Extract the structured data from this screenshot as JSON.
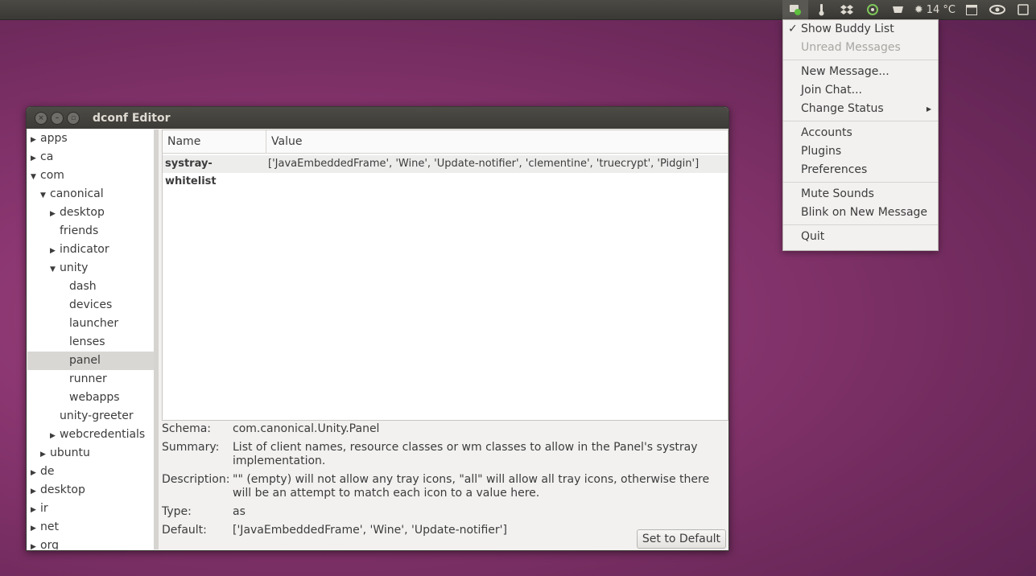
{
  "panel": {
    "temperature": "14 °C",
    "calendar_day": "10",
    "icons": [
      "pidgin-icon",
      "thermometer-icon",
      "dropbox-icon",
      "clementine-icon",
      "cup-icon",
      "weather-icon",
      "calendar-icon",
      "eye-icon",
      "session-icon"
    ]
  },
  "window": {
    "title": "dconf Editor",
    "tree": [
      {
        "label": "apps",
        "depth": 0,
        "arrow": "▶"
      },
      {
        "label": "ca",
        "depth": 0,
        "arrow": "▶"
      },
      {
        "label": "com",
        "depth": 0,
        "arrow": "▼"
      },
      {
        "label": "canonical",
        "depth": 1,
        "arrow": "▼"
      },
      {
        "label": "desktop",
        "depth": 2,
        "arrow": "▶"
      },
      {
        "label": "friends",
        "depth": 2,
        "arrow": ""
      },
      {
        "label": "indicator",
        "depth": 2,
        "arrow": "▶"
      },
      {
        "label": "unity",
        "depth": 2,
        "arrow": "▼"
      },
      {
        "label": "dash",
        "depth": 3,
        "arrow": ""
      },
      {
        "label": "devices",
        "depth": 3,
        "arrow": ""
      },
      {
        "label": "launcher",
        "depth": 3,
        "arrow": ""
      },
      {
        "label": "lenses",
        "depth": 3,
        "arrow": ""
      },
      {
        "label": "panel",
        "depth": 3,
        "arrow": "",
        "selected": true
      },
      {
        "label": "runner",
        "depth": 3,
        "arrow": ""
      },
      {
        "label": "webapps",
        "depth": 3,
        "arrow": ""
      },
      {
        "label": "unity-greeter",
        "depth": 2,
        "arrow": ""
      },
      {
        "label": "webcredentials",
        "depth": 2,
        "arrow": "▶"
      },
      {
        "label": "ubuntu",
        "depth": 1,
        "arrow": "▶"
      },
      {
        "label": "de",
        "depth": 0,
        "arrow": "▶"
      },
      {
        "label": "desktop",
        "depth": 0,
        "arrow": "▶"
      },
      {
        "label": "ir",
        "depth": 0,
        "arrow": "▶"
      },
      {
        "label": "net",
        "depth": 0,
        "arrow": "▶"
      },
      {
        "label": "org",
        "depth": 0,
        "arrow": "▶"
      }
    ],
    "columns": {
      "name": "Name",
      "value": "Value"
    },
    "row": {
      "name": "systray-whitelist",
      "value": "['JavaEmbeddedFrame', 'Wine', 'Update-notifier', 'clementine', 'truecrypt', 'Pidgin']"
    },
    "info": {
      "schema_label": "Schema:",
      "schema": "com.canonical.Unity.Panel",
      "summary_label": "Summary:",
      "summary": "List of client names, resource classes or wm classes to allow in the Panel's systray implementation.",
      "description_label": "Description:",
      "description": "\"\" (empty) will not allow any tray icons, \"all\" will allow all tray icons, otherwise there will be an attempt to match each icon to a value here.",
      "type_label": "Type:",
      "type": "as",
      "default_label": "Default:",
      "default": "['JavaEmbeddedFrame', 'Wine', 'Update-notifier']",
      "button": "Set to Default"
    }
  },
  "menu": {
    "items": [
      {
        "label": "Show Buddy List",
        "checked": true
      },
      {
        "label": "Unread Messages",
        "disabled": true
      },
      {
        "sep": true
      },
      {
        "label": "New Message..."
      },
      {
        "label": "Join Chat..."
      },
      {
        "label": "Change Status",
        "submenu": true
      },
      {
        "sep": true
      },
      {
        "label": "Accounts"
      },
      {
        "label": "Plugins"
      },
      {
        "label": "Preferences"
      },
      {
        "sep": true
      },
      {
        "label": "Mute Sounds"
      },
      {
        "label": "Blink on New Message"
      },
      {
        "sep": true
      },
      {
        "label": "Quit"
      }
    ]
  }
}
